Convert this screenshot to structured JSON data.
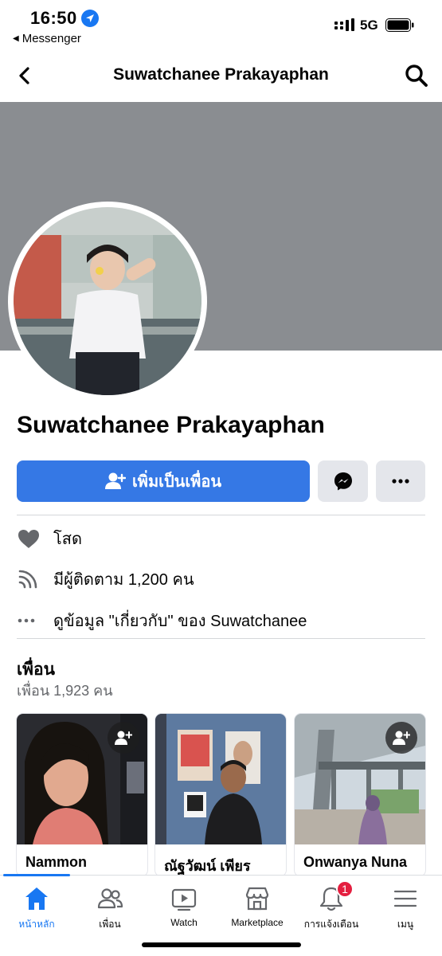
{
  "status": {
    "time": "16:50",
    "back_app": "Messenger",
    "network": "5G"
  },
  "header": {
    "title": "Suwatchanee Prakayaphan"
  },
  "profile": {
    "name": "Suwatchanee Prakayaphan",
    "add_friend_label": "เพิ่มเป็นเพื่อน"
  },
  "info": {
    "relationship": "โสด",
    "followers": "มีผู้ติดตาม 1,200 คน",
    "about": "ดูข้อมูล \"เกี่ยวกับ\" ของ Suwatchanee"
  },
  "friends": {
    "title": "เพื่อน",
    "count": "เพื่อน 1,923 คน",
    "items": [
      {
        "name": "Nammon"
      },
      {
        "name": "ณัฐวัฒน์ เพียร"
      },
      {
        "name": "Onwanya Nuna"
      }
    ]
  },
  "tabs": [
    {
      "label": "หน้าหลัก",
      "icon": "home-icon",
      "active": true
    },
    {
      "label": "เพื่อน",
      "icon": "friends-icon"
    },
    {
      "label": "Watch",
      "icon": "watch-icon"
    },
    {
      "label": "Marketplace",
      "icon": "marketplace-icon"
    },
    {
      "label": "การแจ้งเตือน",
      "icon": "bell-icon",
      "badge": "1"
    },
    {
      "label": "เมนู",
      "icon": "menu-icon"
    }
  ],
  "colors": {
    "accent": "#1877f2",
    "button_blue": "#3578e5",
    "cover_gray": "#8a8d91",
    "badge_red": "#e41e3f"
  }
}
